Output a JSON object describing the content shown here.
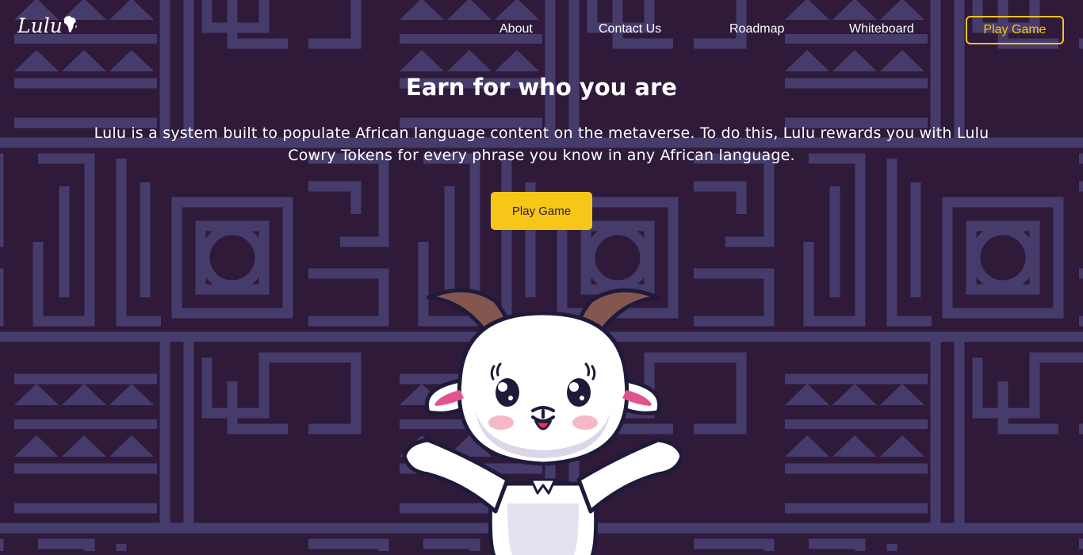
{
  "brand": {
    "logo_text": "Lulu"
  },
  "nav": {
    "links": [
      "About",
      "Contact Us",
      "Roadmap",
      "Whiteboard"
    ],
    "cta_label": "Play Game"
  },
  "hero": {
    "title": "Earn for who you are",
    "description": "Lulu is a system built to populate African language content on the metaverse. To do this, Lulu rewards you with Lulu Cowry Tokens for every phrase you know in any African language.",
    "cta_label": "Play Game"
  },
  "colors": {
    "background": "#2f1a3a",
    "pattern": "#463c6b",
    "accent": "#f7c619",
    "text": "#ffffff"
  },
  "icons": [
    "africa-map-icon"
  ]
}
